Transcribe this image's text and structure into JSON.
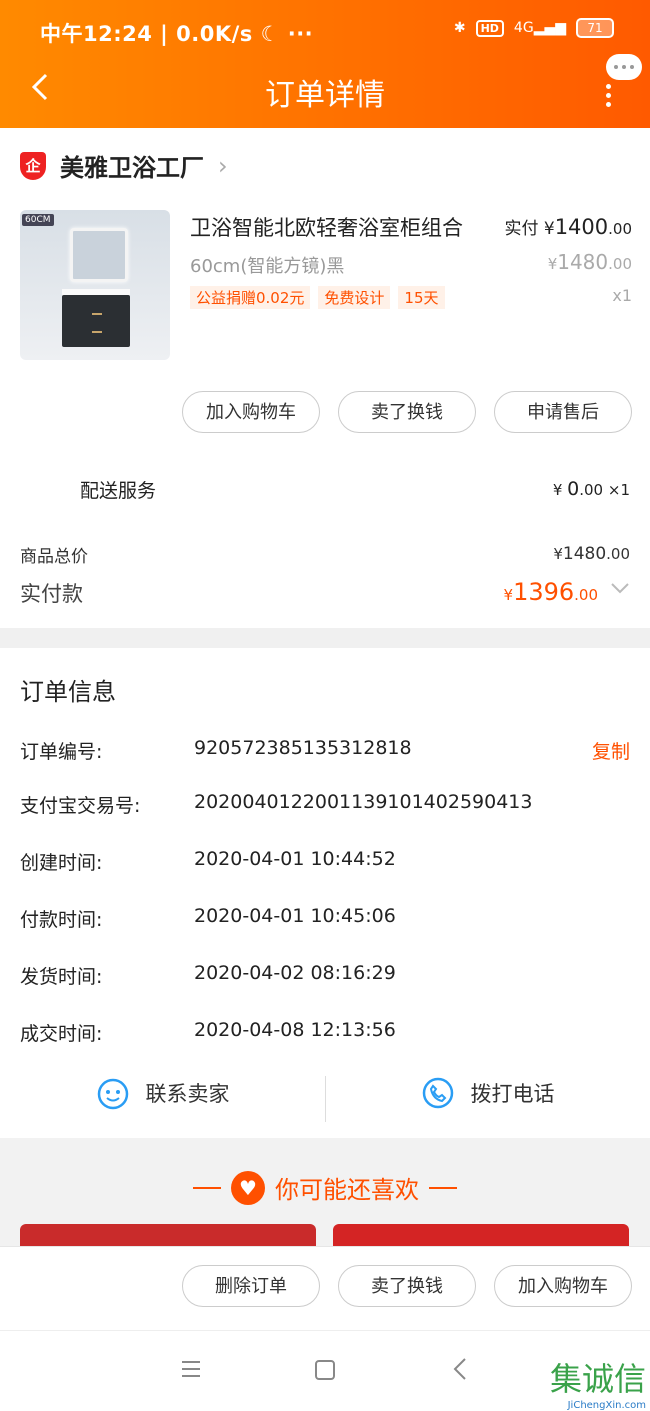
{
  "status_bar": {
    "time": "中午12:24 | 0.0K/s ☾  ···",
    "net": "4G",
    "hd": "HD",
    "battery": "71"
  },
  "header": {
    "title": "订单详情"
  },
  "seller": {
    "name": "美雅卫浴工厂",
    "badge": "企"
  },
  "product": {
    "thumb_tag": "60CM",
    "name": "卫浴智能北欧轻奢浴室柜组合",
    "spec": "60cm(智能方镜)黑",
    "tags": [
      "公益捐赠0.02元",
      "免费设计",
      "15天"
    ],
    "paid_label": "实付",
    "paid_int": "1400",
    "paid_dec": ".00",
    "orig_int": "1480",
    "orig_dec": ".00",
    "qty": "x1",
    "currency": "¥"
  },
  "actions": {
    "add_cart": "加入购物车",
    "sell": "卖了换钱",
    "after_sale": "申请售后"
  },
  "shipping": {
    "label": "配送服务",
    "price_int": "0",
    "price_dec": ".00",
    "qty": "×1"
  },
  "totals": {
    "goods_label": "商品总价",
    "goods_int": "1480",
    "goods_dec": ".00",
    "paid_label": "实付款",
    "paid_int": "1396",
    "paid_dec": ".00"
  },
  "order_info": {
    "title": "订单信息",
    "copy": "复制",
    "rows": [
      {
        "label": "订单编号:",
        "value": "920572385135312818"
      },
      {
        "label": "支付宝交易号:",
        "value": "2020040122001139101402590413"
      },
      {
        "label": "创建时间:",
        "value": "2020-04-01 10:44:52"
      },
      {
        "label": "付款时间:",
        "value": "2020-04-01 10:45:06"
      },
      {
        "label": "发货时间:",
        "value": "2020-04-02 08:16:29"
      },
      {
        "label": "成交时间:",
        "value": "2020-04-08 12:13:56"
      }
    ]
  },
  "contact": {
    "seller": "联系卖家",
    "phone": "拨打电话"
  },
  "recommend": {
    "title": "你可能还喜欢"
  },
  "bottom_actions": {
    "delete": "删除订单",
    "sell": "卖了换钱",
    "add_cart": "加入购物车"
  },
  "watermark": {
    "text": "集诚信",
    "url": "JiChengXin.com"
  },
  "colors": {
    "accent": "#ff5000",
    "header_start": "#ff8a00",
    "header_end": "#ff5a00"
  }
}
